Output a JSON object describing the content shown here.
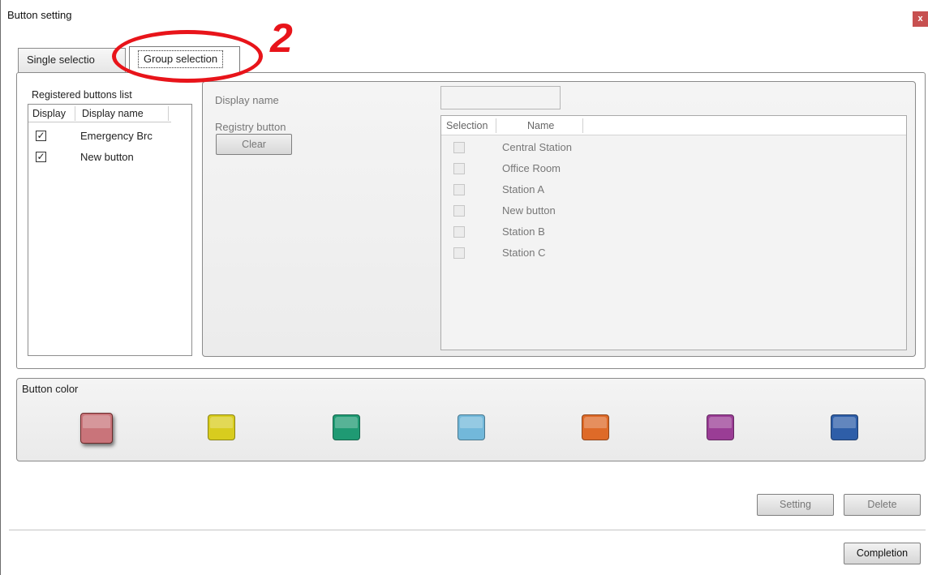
{
  "window": {
    "title": "Button setting",
    "close_label": "x"
  },
  "tabs": [
    {
      "label": "Single selectio"
    },
    {
      "label": "Group selection"
    }
  ],
  "annotation": {
    "number": "2"
  },
  "registered": {
    "label": "Registered buttons list",
    "columns": [
      "Display",
      "Display name"
    ],
    "rows": [
      {
        "checked": "✓",
        "name": "Emergency Brc"
      },
      {
        "checked": "✓",
        "name": "New button"
      }
    ]
  },
  "detail": {
    "display_name_label": "Display name",
    "display_name_value": "",
    "registry_label": "Registry button",
    "clear_label": "Clear"
  },
  "selection": {
    "columns": [
      "Selection",
      "Name"
    ],
    "rows": [
      {
        "name": "Central Station"
      },
      {
        "name": "Office Room"
      },
      {
        "name": "Station A"
      },
      {
        "name": "New button"
      },
      {
        "name": "Station B"
      },
      {
        "name": "Station C"
      }
    ]
  },
  "colors": {
    "label": "Button color",
    "swatches": [
      {
        "name": "red",
        "color": "#c9747a",
        "selected": true
      },
      {
        "name": "yellow",
        "color": "#d8cc1e"
      },
      {
        "name": "green",
        "color": "#1f9a73"
      },
      {
        "name": "light-blue",
        "color": "#72b8da"
      },
      {
        "name": "orange",
        "color": "#de6a28"
      },
      {
        "name": "purple",
        "color": "#9a3d95"
      },
      {
        "name": "blue",
        "color": "#2e5ea8"
      }
    ]
  },
  "buttons": {
    "setting": "Setting",
    "delete": "Delete",
    "completion": "Completion"
  }
}
